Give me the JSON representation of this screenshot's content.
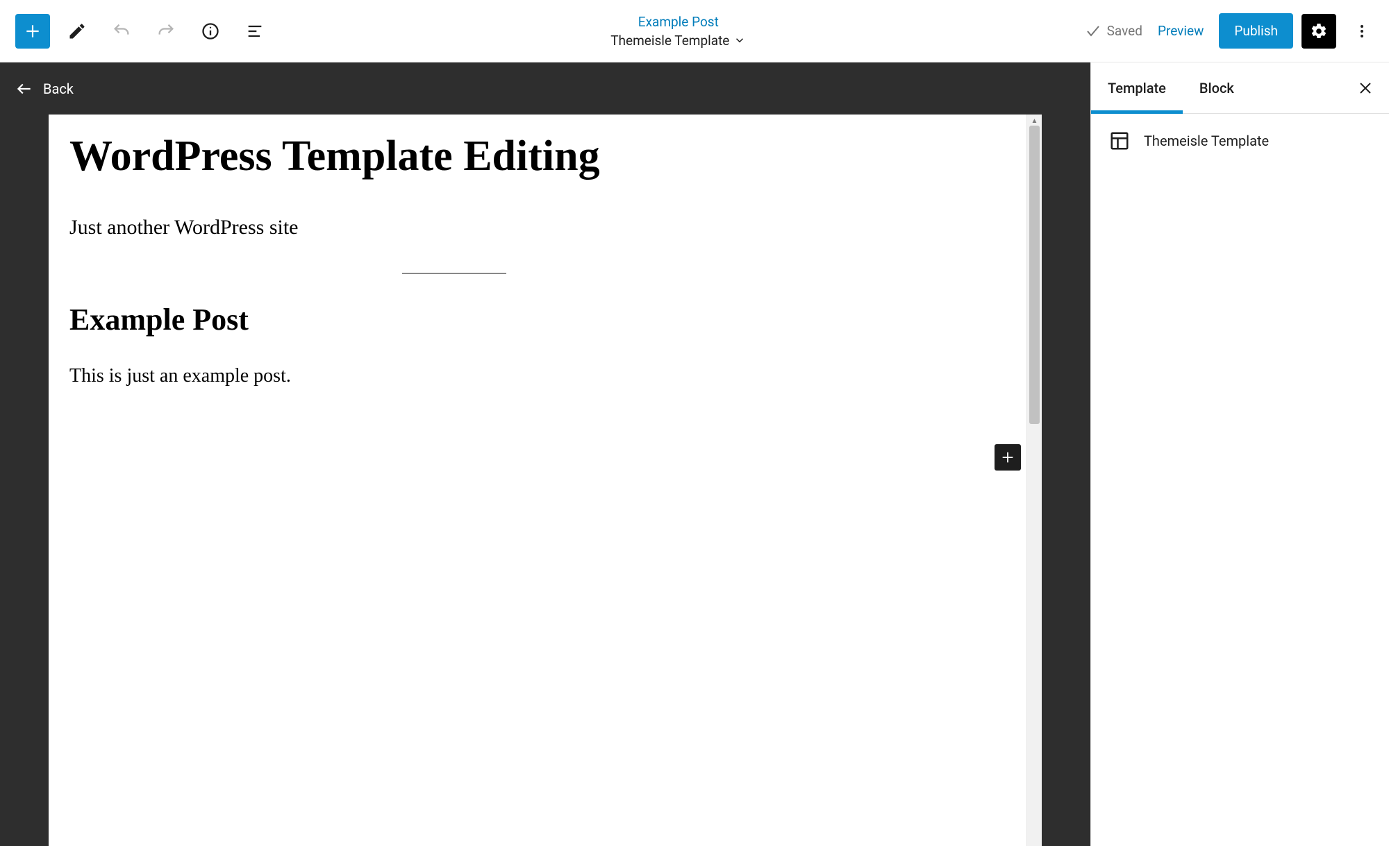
{
  "toolbar": {
    "doc_title": "Example Post",
    "doc_subtitle": "Themeisle Template",
    "saved_label": "Saved",
    "preview_label": "Preview",
    "publish_label": "Publish"
  },
  "canvas": {
    "back_label": "Back",
    "site_title": "WordPress Template Editing",
    "site_tagline": "Just another WordPress site",
    "post_title": "Example Post",
    "post_body": "This is just an example post."
  },
  "sidebar": {
    "tabs": {
      "template": "Template",
      "block": "Block"
    },
    "template_name": "Themeisle Template"
  }
}
